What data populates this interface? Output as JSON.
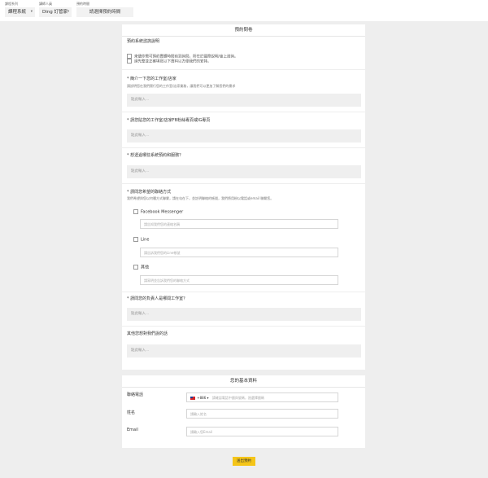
{
  "topbar": {
    "course_category_label": "課程系列",
    "course_category_value": "課程系統",
    "instructor_label": "講師人員",
    "instructor_value": "Ding 訂管家",
    "appointment_label": "預約時間",
    "appointment_button": "請選擇預約時間"
  },
  "booking": {
    "title": "預約問卷",
    "policy_title": "預約系統諮詢說明",
    "policy_items": [
      "來儘你需可預約實體時間前到詢問，所在於國際說明/會上諮詢。",
      "請先整並正確填寫以下資料以方便我們的安排。"
    ],
    "questions": [
      {
        "title": "* 簡介一下您的工作室/店家",
        "desc": "請說明您在我們實行您的工作室/店家業務，讓我們可以更加了解您們的需求",
        "placeholder": "點此輸入..."
      },
      {
        "title": "* 請您貼您的工作室/店家FB粉絲專頁或IG專頁",
        "desc": "",
        "placeholder": "點此輸入..."
      },
      {
        "title": "* 想透過哪些系統預約和服務？",
        "desc": "",
        "placeholder": "點此輸入..."
      },
      {
        "title": "* 請問您希望的聯絡方式",
        "desc": "我們希望與您以何種方式聯繫，請在勾在下，並註明聯絡的帳號，我們將用粉以電話或email 聯繫您。",
        "placeholder": ""
      },
      {
        "title": "* 請問您的負責人是哪間工作室？",
        "desc": "",
        "placeholder": "點此輸入..."
      },
      {
        "title": "其他您想對我們說的話",
        "desc": "",
        "placeholder": "點此輸入..."
      }
    ],
    "contact_options": [
      {
        "label": "Facebook Messenger",
        "placeholder": "請告知我們您的連絡名稱"
      },
      {
        "label": "Line",
        "placeholder": "請告訴我們您的Line帳號"
      },
      {
        "label": "其他",
        "placeholder": "請寫明並告訴我們您的聯絡方式"
      }
    ]
  },
  "basic_info": {
    "title": "您的基本資料",
    "phone_label": "聯絡電話",
    "phone_code": "+886 ▾",
    "phone_placeholder": "請確認電話中國與號碼，過選擇國碼",
    "name_label": "姓名",
    "name_placeholder": "請輸入姓名",
    "email_label": "Email",
    "email_placeholder": "請輸入您Email"
  },
  "submit_label": "送出預約",
  "colors": {
    "background": "#eeeeee",
    "input_fill": "#efefef",
    "submit": "#f5c518"
  },
  "icons": {
    "dropdown": "caret-down-icon",
    "flag": "taiwan-flag-icon",
    "checkbox": "checkbox-icon"
  }
}
